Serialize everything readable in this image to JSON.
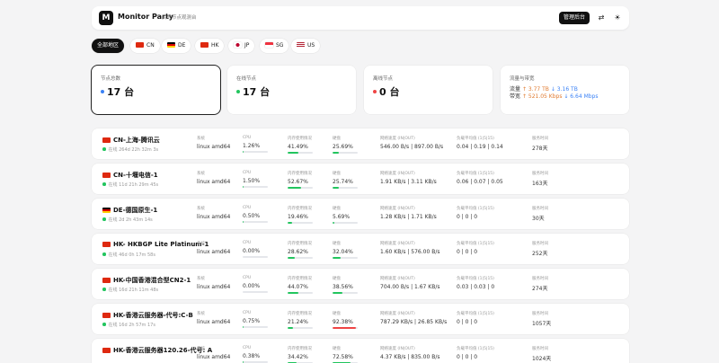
{
  "header": {
    "brand": "Monitor Party",
    "subtitle": "实时节点观测台",
    "admin_label": "管理后台",
    "icons": [
      "translate-icon",
      "theme-icon"
    ]
  },
  "filters": [
    {
      "label": "全部地区",
      "flag": "",
      "active": true
    },
    {
      "label": "CN",
      "flag": "cn",
      "active": false
    },
    {
      "label": "DE",
      "flag": "de",
      "active": false
    },
    {
      "label": "HK",
      "flag": "hk",
      "active": false
    },
    {
      "label": "JP",
      "flag": "jp",
      "active": false
    },
    {
      "label": "SG",
      "flag": "sg",
      "active": false
    },
    {
      "label": "US",
      "flag": "us",
      "active": false
    }
  ],
  "stats": {
    "total": {
      "label": "节点总数",
      "value": "17 台",
      "dot_color": "#3b82f6"
    },
    "online": {
      "label": "在线节点",
      "value": "17 台",
      "dot_color": "#22c55e"
    },
    "offline": {
      "label": "离线节点",
      "value": "0 台",
      "dot_color": "#ef4444"
    },
    "traffic": {
      "label": "流量与带宽",
      "line1_prefix": "流量",
      "line1_up": "↑ 3.77 TB",
      "line1_down": "↓ 3.16 TB",
      "line2_prefix": "带宽",
      "line2_up": "↑ 521.05 Kbps",
      "line2_down": "↓ 6.64 Mbps"
    }
  },
  "labels": {
    "system": "系统",
    "cpu": "CPU",
    "memory": "内存使用情况",
    "disk": "硬盘",
    "network": "网络速度 (IN|OUT)",
    "load": "负载平均值 (1|5|15)",
    "uptime": "服务时间"
  },
  "servers": [
    {
      "flag": "cn",
      "name": "CN-上海-腾讯云",
      "online": "在线 264d 22h 32m 3s",
      "system": "linux amd64",
      "cpu": "1.26%",
      "cpu_pct": 1.26,
      "memory": "41.49%",
      "mem_pct": 41.49,
      "disk": "25.69%",
      "disk_pct": 25.69,
      "network": "546.00 B/s | 897.00 B/s",
      "load": "0.04 | 0.19 | 0.14",
      "uptime": "278天"
    },
    {
      "flag": "cn",
      "name": "CN-十堰电信-1",
      "online": "在线 11d 21h 29m 45s",
      "system": "linux amd64",
      "cpu": "1.50%",
      "cpu_pct": 1.5,
      "memory": "52.67%",
      "mem_pct": 52.67,
      "disk": "25.74%",
      "disk_pct": 25.74,
      "network": "1.91 KB/s | 3.11 KB/s",
      "load": "0.06 | 0.07 | 0.05",
      "uptime": "163天"
    },
    {
      "flag": "de",
      "name": "DE-德国原生-1",
      "online": "在线 2d 2h 43m 14s",
      "system": "linux amd64",
      "cpu": "0.50%",
      "cpu_pct": 0.5,
      "memory": "19.46%",
      "mem_pct": 19.46,
      "disk": "5.69%",
      "disk_pct": 5.69,
      "network": "1.28 KB/s | 1.71 KB/s",
      "load": "0 | 0 | 0",
      "uptime": "30天"
    },
    {
      "flag": "hk",
      "name": "HK- HKBGP Lite Platinum-1",
      "online": "在线 46d 0h 17m 58s",
      "system": "linux amd64",
      "cpu": "0.00%",
      "cpu_pct": 0,
      "memory": "28.62%",
      "mem_pct": 28.62,
      "disk": "32.04%",
      "disk_pct": 32.04,
      "network": "1.60 KB/s | 576.00 B/s",
      "load": "0 | 0 | 0",
      "uptime": "252天"
    },
    {
      "flag": "hk",
      "name": "HK-中国香港混合型CN2-1",
      "online": "在线 16d 21h 11m 48s",
      "system": "linux amd64",
      "cpu": "0.00%",
      "cpu_pct": 0,
      "memory": "44.07%",
      "mem_pct": 44.07,
      "disk": "38.56%",
      "disk_pct": 38.56,
      "network": "704.00 B/s | 1.67 KB/s",
      "load": "0.03 | 0.03 | 0",
      "uptime": "274天"
    },
    {
      "flag": "hk",
      "name": "HK-香港云服务器-代号:C-B",
      "online": "在线 16d 2h 57m 17s",
      "system": "linux amd64",
      "cpu": "0.75%",
      "cpu_pct": 0.75,
      "memory": "21.24%",
      "mem_pct": 21.24,
      "disk": "92.38%",
      "disk_pct": 92.38,
      "network": "787.29 KB/s | 26.85 KB/s",
      "load": "0 | 0 | 0",
      "uptime": "1057天"
    },
    {
      "flag": "hk",
      "name": "HK-香港云服务器120.26-代号: A",
      "online": "",
      "system": "linux amd64",
      "cpu": "0.38%",
      "cpu_pct": 0.38,
      "memory": "34.42%",
      "mem_pct": 34.42,
      "disk": "72.58%",
      "disk_pct": 72.58,
      "network": "4.37 KB/s | 835.00 B/s",
      "load": "0 | 0 | 0",
      "uptime": "1024天"
    }
  ],
  "colors": {
    "bar_normal": "#22c55e",
    "bar_high": "#ef4444",
    "bar_track": "#e5e7eb"
  }
}
